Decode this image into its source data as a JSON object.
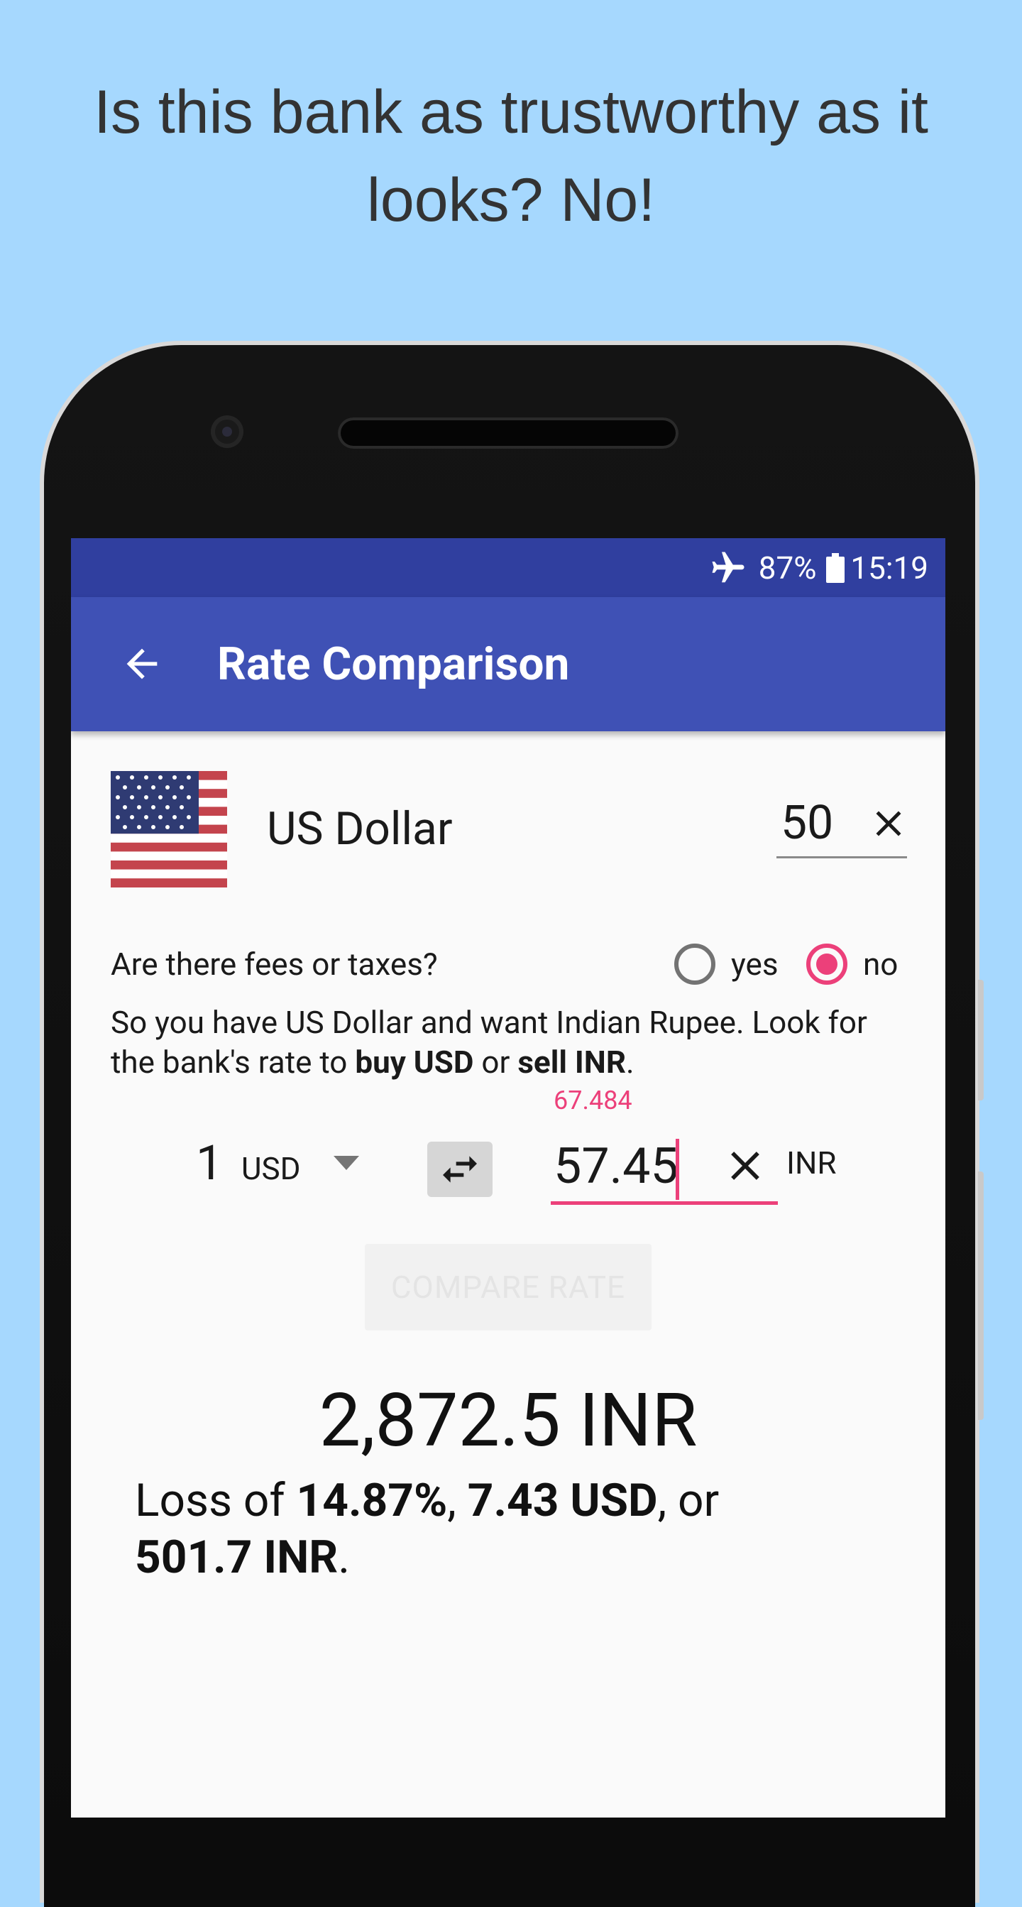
{
  "caption": {
    "line1": "Is this bank as trustworthy as it",
    "line2": "looks? No!"
  },
  "status_bar": {
    "battery_percent": "87%",
    "time": "15:19",
    "icons": [
      "airplane-mode-icon",
      "battery-icon"
    ]
  },
  "app_bar": {
    "title": "Rate Comparison",
    "back_icon": "arrow-left-icon"
  },
  "source_currency": {
    "flag_icon": "us-flag-icon",
    "name": "US Dollar",
    "amount": "50"
  },
  "fees": {
    "question": "Are there fees or taxes?",
    "options": [
      {
        "label": "yes",
        "selected": false
      },
      {
        "label": "no",
        "selected": true
      }
    ]
  },
  "hint": {
    "part1": "So you have US Dollar and want Indian Rupee. Look for the bank's rate to ",
    "bold1": "buy USD",
    "part2": " or ",
    "bold2": "sell INR",
    "part3": "."
  },
  "rate_entry": {
    "suggested_rate": "67.484",
    "unit_amount": "1",
    "unit_currency": "USD",
    "rate_value": "57.45",
    "target_currency": "INR"
  },
  "compare_button": {
    "label": "COMPARE RATE",
    "enabled": false
  },
  "result": {
    "amount": "2,872.5 INR",
    "loss_prefix": "Loss of ",
    "loss_percent": "14.87%",
    "sep1": ", ",
    "loss_source": "7.43 USD",
    "sep2": ", or",
    "loss_target": "501.7 INR",
    "suffix": "."
  },
  "colors": {
    "background": "#a6d8fe",
    "status_bar": "#303f9f",
    "app_bar": "#3f51b5",
    "accent": "#ec407a"
  }
}
